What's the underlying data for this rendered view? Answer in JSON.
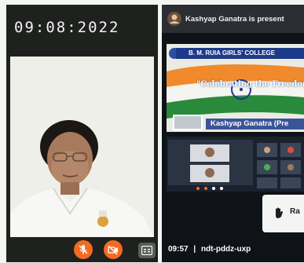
{
  "left_panel": {
    "date_overlay": "09:08:2022",
    "controls": {
      "mic_icon": "mic-off-icon",
      "camera_icon": "camera-off-icon",
      "captions_icon": "captions-icon"
    }
  },
  "right_panel": {
    "banner_text": "Kashyap Ganatra is present",
    "slide": {
      "college_name": "B. M. RUIA GIRLS' COLLEGE",
      "celebrate_text": "\"Celebrating the Freedom",
      "presenter_tag": "Kashyap Ganatra (Pre"
    },
    "popup_label": "Ra",
    "meeting_time": "09:57",
    "meeting_separator": "|",
    "meeting_code": "ndt-pddz-uxp"
  },
  "colors": {
    "accent_orange": "#f26b21",
    "dark_bg": "#1f211f",
    "college_blue": "#1d3a8a"
  }
}
